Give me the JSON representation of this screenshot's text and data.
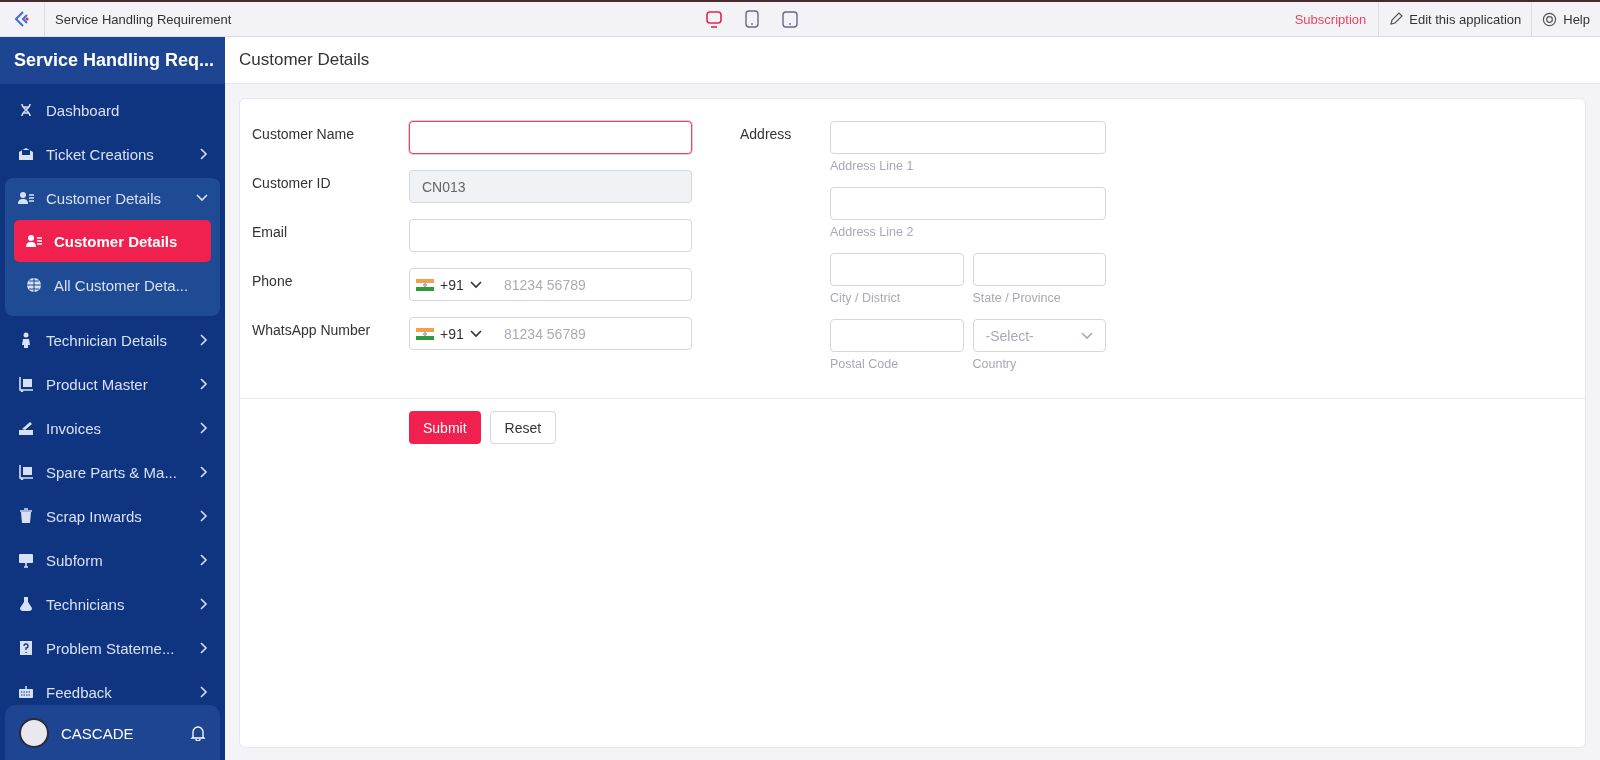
{
  "topbar": {
    "app_title": "Service Handling Requirement",
    "devices": [
      {
        "kind": "desktop",
        "selected": true
      },
      {
        "kind": "tablet",
        "selected": false
      },
      {
        "kind": "phone",
        "selected": false
      }
    ],
    "subscription": "Subscription",
    "edit": "Edit this application",
    "help": "Help"
  },
  "sidebar": {
    "title": "Service Handling Req...",
    "items": [
      {
        "label": "Dashboard"
      },
      {
        "label": "Ticket Creations",
        "expanded": false
      },
      {
        "label": "Customer Details",
        "expanded": true,
        "children": [
          {
            "label": "Customer Details",
            "selected": true
          },
          {
            "label": "All Customer Deta...",
            "selected": false
          }
        ]
      },
      {
        "label": "Technician Details",
        "expanded": false
      },
      {
        "label": "Product Master",
        "expanded": false
      },
      {
        "label": "Invoices",
        "expanded": false
      },
      {
        "label": "Spare Parts & Ma...",
        "expanded": false
      },
      {
        "label": "Scrap Inwards",
        "expanded": false
      },
      {
        "label": "Subform",
        "expanded": false
      },
      {
        "label": "Technicians",
        "expanded": false
      },
      {
        "label": "Problem Stateme...",
        "expanded": false
      },
      {
        "label": "Feedback",
        "expanded": false
      }
    ],
    "user": {
      "name": "CASCADE"
    }
  },
  "page_title": "Customer Details",
  "form": {
    "fields": [
      {
        "label": "Customer Name",
        "kind": "text",
        "focused": true,
        "disabled": false
      },
      {
        "label": "Customer ID",
        "kind": "text",
        "value": "CN013",
        "focused": false,
        "disabled": true
      },
      {
        "label": "Email",
        "kind": "text",
        "focused": false,
        "disabled": false
      },
      {
        "label": "Phone",
        "kind": "phone",
        "code": "+91",
        "placeholder": "81234 56789"
      },
      {
        "label": "WhatsApp Number",
        "kind": "phone",
        "code": "+91",
        "placeholder": "81234 56789"
      }
    ],
    "address": {
      "label": "Address",
      "rows": [
        [
          {
            "kind": "text",
            "caption": "Address Line 1"
          }
        ],
        [
          {
            "kind": "text",
            "caption": "Address Line 2"
          }
        ],
        [
          {
            "kind": "text",
            "caption": "City / District"
          },
          {
            "kind": "text",
            "caption": "State / Province"
          }
        ],
        [
          {
            "kind": "text",
            "caption": "Postal Code"
          },
          {
            "kind": "select",
            "caption": "Country",
            "value": "-Select-"
          }
        ]
      ]
    },
    "buttons": [
      {
        "label": "Submit",
        "kind": "primary"
      },
      {
        "label": "Reset",
        "kind": "secondary"
      }
    ]
  }
}
